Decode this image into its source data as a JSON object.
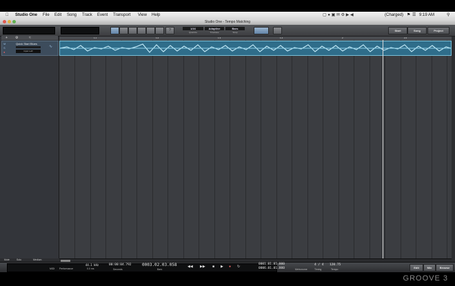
{
  "menubar": {
    "apple": "",
    "app_name": "Studio One",
    "items": [
      "File",
      "Edit",
      "Song",
      "Track",
      "Event",
      "Transport",
      "View",
      "Help"
    ],
    "battery": "(Charged)",
    "clock": "9:19 AM"
  },
  "window": {
    "title": "Studio One - Tempo Matching"
  },
  "toolbar": {
    "quantize_value": "1/16",
    "quantize_label": "Quantize",
    "timebase_value": "Adaptive",
    "timebase_label": "Timebase",
    "snap_value": "Bars",
    "snap_label": "Snap",
    "start_label": "Start",
    "song_label": "Song",
    "project_label": "Project",
    "help_label": "?"
  },
  "track": {
    "name": "Quick Start Blues",
    "input": "Input L+R"
  },
  "ruler": {
    "marks": [
      "1.1",
      "1.2",
      "1.3",
      "1.4",
      "2",
      "2.2",
      "2.3"
    ]
  },
  "transport": {
    "sample_rate": "44.1 kHz",
    "record_time": "0.0 ms",
    "midi_label": "MIDI",
    "perf_label": "Performance",
    "time_value": "00:00:04.792",
    "seconds_label": "Seconds",
    "bars_value": "0003.02.03.058",
    "bars_label": "Bars",
    "loop_start": "0001.01.01.000",
    "loop_end": "0006.01.01.000",
    "metronome_label": "Metronome",
    "timesig": "4 / 4",
    "timing_label": "Timing",
    "tempo_value": "120.75",
    "tempo_label": "Tempo",
    "edit_label": "Edit",
    "mix_label": "Mix",
    "browse_label": "Browse"
  },
  "footer": {
    "tab_mute": "Mute",
    "tab_solo": "Solo",
    "tab_zoom": "Medium"
  },
  "watermark": "GROOVE 3"
}
